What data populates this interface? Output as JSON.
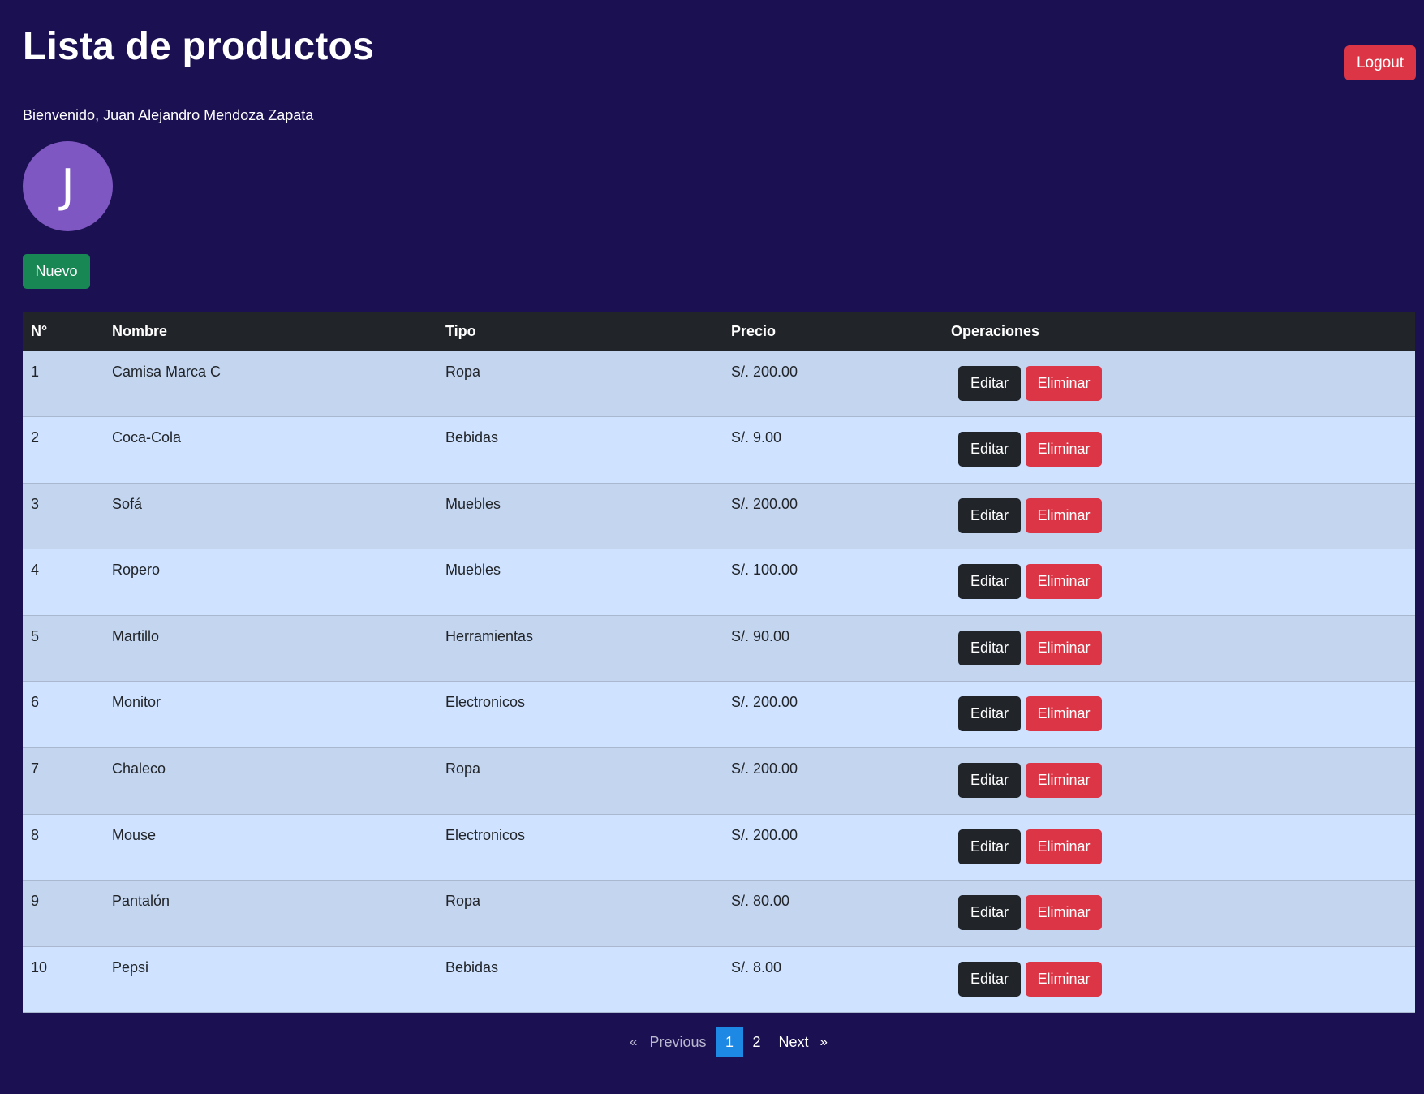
{
  "header": {
    "title": "Lista de productos",
    "logout_label": "Logout",
    "welcome": "Bienvenido, Juan Alejandro Mendoza Zapata",
    "avatar_initial": "J",
    "new_label": "Nuevo"
  },
  "table": {
    "columns": [
      "N°",
      "Nombre",
      "Tipo",
      "Precio",
      "Operaciones"
    ],
    "edit_label": "Editar",
    "delete_label": "Eliminar",
    "rows": [
      {
        "n": "1",
        "nombre": "Camisa Marca C",
        "tipo": "Ropa",
        "precio": "S/. 200.00"
      },
      {
        "n": "2",
        "nombre": "Coca-Cola",
        "tipo": "Bebidas",
        "precio": "S/. 9.00"
      },
      {
        "n": "3",
        "nombre": "Sofá",
        "tipo": "Muebles",
        "precio": "S/. 200.00"
      },
      {
        "n": "4",
        "nombre": "Ropero",
        "tipo": "Muebles",
        "precio": "S/. 100.00"
      },
      {
        "n": "5",
        "nombre": "Martillo",
        "tipo": "Herramientas",
        "precio": "S/. 90.00"
      },
      {
        "n": "6",
        "nombre": "Monitor",
        "tipo": "Electronicos",
        "precio": "S/. 200.00"
      },
      {
        "n": "7",
        "nombre": "Chaleco",
        "tipo": "Ropa",
        "precio": "S/. 200.00"
      },
      {
        "n": "8",
        "nombre": "Mouse",
        "tipo": "Electronicos",
        "precio": "S/. 200.00"
      },
      {
        "n": "9",
        "nombre": "Pantalón",
        "tipo": "Ropa",
        "precio": "S/. 80.00"
      },
      {
        "n": "10",
        "nombre": "Pepsi",
        "tipo": "Bebidas",
        "precio": "S/. 8.00"
      }
    ]
  },
  "pagination": {
    "prev_chevron": "«",
    "prev_label": "Previous",
    "pages": [
      "1",
      "2"
    ],
    "active_page": "1",
    "next_label": "Next",
    "next_chevron": "»"
  },
  "colors": {
    "background": "#1b1052",
    "logout": "#dc3545",
    "nuevo": "#198754",
    "avatar": "#7e57c2",
    "table_header": "#212529",
    "row_odd": "#c4d5f0",
    "row_even": "#cfe2ff",
    "active_page": "#1e88e5"
  }
}
